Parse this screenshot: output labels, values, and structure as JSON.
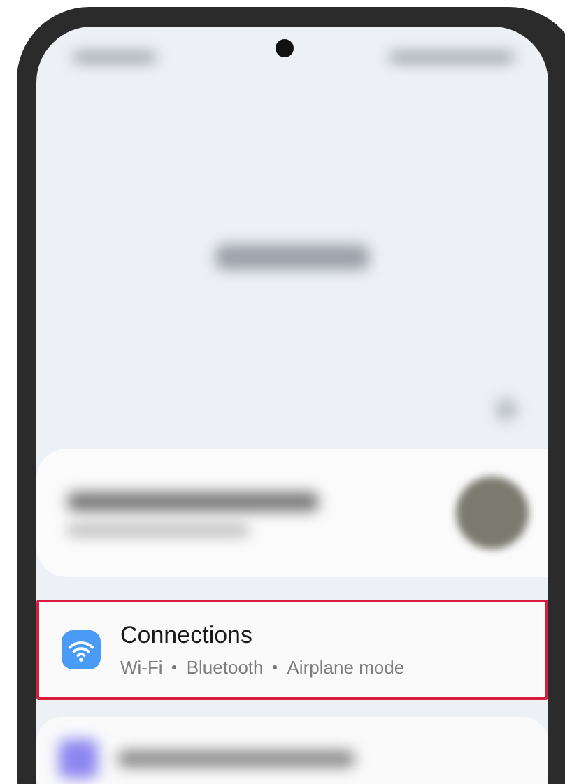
{
  "settings_list": [
    {
      "kind": "blurred"
    },
    {
      "kind": "item",
      "title": "Connections",
      "subtitles": [
        "Wi-Fi",
        "Bluetooth",
        "Airplane mode"
      ],
      "highlighted": true
    },
    {
      "kind": "blurred"
    }
  ]
}
